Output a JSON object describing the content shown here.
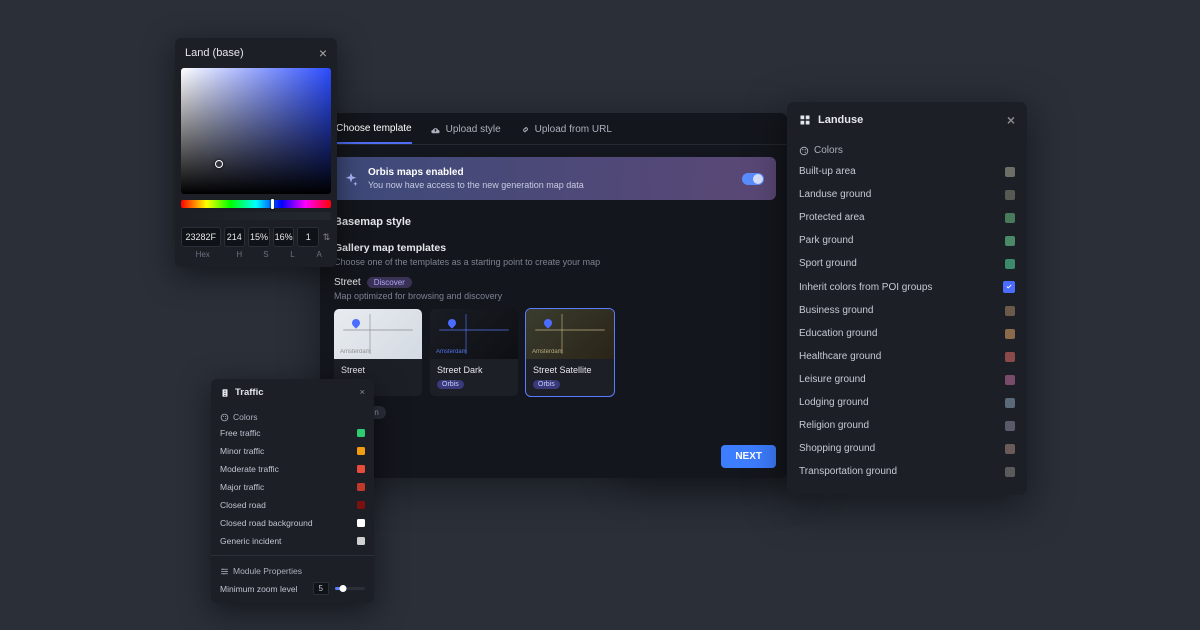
{
  "color_picker": {
    "title": "Land (base)",
    "hex": "23282F",
    "h": "214",
    "s": "15%",
    "l": "16%",
    "a": "1",
    "labels": {
      "hex": "Hex",
      "h": "H",
      "s": "S",
      "l": "L",
      "a": "A"
    }
  },
  "main": {
    "tabs": {
      "choose": "Choose template",
      "upload": "Upload style",
      "url": "Upload from URL"
    },
    "banner": {
      "title": "Orbis maps enabled",
      "subtitle": "You now have access to the new generation map data"
    },
    "basemap_title": "Basemap style",
    "gallery_title": "Gallery map templates",
    "gallery_help": "Choose one of the templates as a starting point to create your map",
    "category": {
      "name": "Street",
      "badge": "Discover"
    },
    "category_help": "Map optimized for browsing and discovery",
    "templates": [
      {
        "name": "Street",
        "city": "Amsterdam",
        "badge": ""
      },
      {
        "name": "Street Dark",
        "city": "Amsterdam",
        "badge": "Orbis"
      },
      {
        "name": "Street Satellite",
        "city": "Amsterdam",
        "badge": "Orbis"
      }
    ],
    "nav_pill": "Navigation",
    "next": "NEXT"
  },
  "map": {
    "caption": "Street Satellite"
  },
  "traffic": {
    "title": "Traffic",
    "colors_label": "Colors",
    "items": [
      {
        "label": "Free traffic",
        "color": "#2ecc71"
      },
      {
        "label": "Minor traffic",
        "color": "#f39c12"
      },
      {
        "label": "Moderate traffic",
        "color": "#e74c3c"
      },
      {
        "label": "Major traffic",
        "color": "#c0392b"
      },
      {
        "label": "Closed road",
        "color": "#7a1010"
      },
      {
        "label": "Closed road background",
        "color": "#ffffff"
      },
      {
        "label": "Generic incident",
        "color": "#d0d0d0"
      }
    ],
    "module_title": "Module Properties",
    "zoom_label": "Minimum zoom level",
    "zoom_value": "5"
  },
  "landuse": {
    "title": "Landuse",
    "colors_label": "Colors",
    "inherit_label": "Inherit colors from POI groups",
    "items": [
      {
        "label": "Built-up area",
        "color": "#6b6f66"
      },
      {
        "label": "Landuse ground",
        "color": "#565a52"
      },
      {
        "label": "Protected area",
        "color": "#4a7a5c"
      },
      {
        "label": "Park ground",
        "color": "#4a8a66"
      },
      {
        "label": "Sport ground",
        "color": "#3d8a6a"
      },
      {
        "label": "Business ground",
        "color": "#6b5a4a"
      },
      {
        "label": "Education ground",
        "color": "#8a6a4a"
      },
      {
        "label": "Healthcare ground",
        "color": "#8a4a4a"
      },
      {
        "label": "Leisure ground",
        "color": "#7a4a6a"
      },
      {
        "label": "Lodging ground",
        "color": "#5a6a7a"
      },
      {
        "label": "Religion ground",
        "color": "#5a5a6a"
      },
      {
        "label": "Shopping ground",
        "color": "#6a5a5a"
      },
      {
        "label": "Transportation ground",
        "color": "#5a5a5a"
      }
    ]
  }
}
